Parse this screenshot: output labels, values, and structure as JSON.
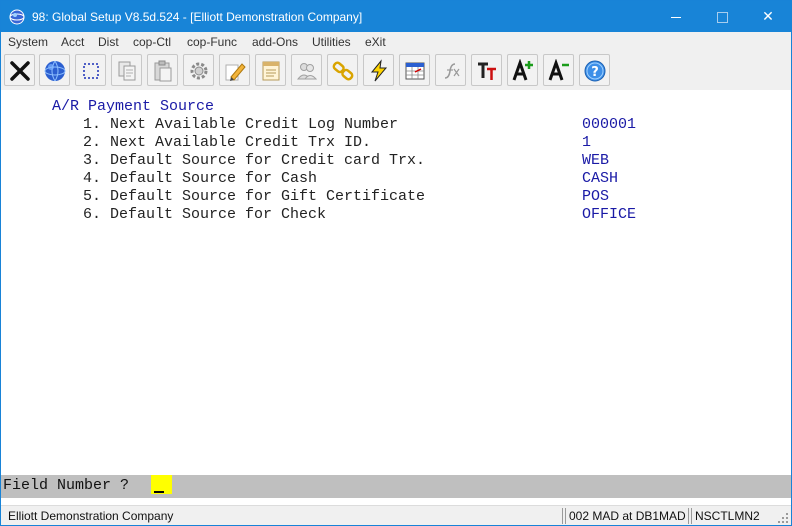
{
  "window": {
    "title": "98: Global Setup V8.5d.524 - [Elliott Demonstration Company]",
    "controls": {
      "minimize": "minimize",
      "maximize": "maximize",
      "close": "✕"
    }
  },
  "menubar": {
    "items": [
      {
        "label": "System"
      },
      {
        "label": "Acct"
      },
      {
        "label": "Dist"
      },
      {
        "label": "cop-Ctl"
      },
      {
        "label": "cop-Func"
      },
      {
        "label": "add-Ons"
      },
      {
        "label": "Utilities"
      },
      {
        "label": "eXit"
      }
    ]
  },
  "toolbar": {
    "buttons": [
      {
        "icon": "exit-x-icon"
      },
      {
        "icon": "globe-icon"
      },
      {
        "icon": "select-box-icon"
      },
      {
        "icon": "copy-icon"
      },
      {
        "icon": "paste-icon"
      },
      {
        "icon": "settings-gear-icon"
      },
      {
        "icon": "pencil-edit-icon"
      },
      {
        "icon": "notepad-icon"
      },
      {
        "icon": "users-icon"
      },
      {
        "icon": "chain-link-icon"
      },
      {
        "icon": "lightning-icon"
      },
      {
        "icon": "spreadsheet-icon"
      },
      {
        "icon": "function-icon"
      },
      {
        "icon": "font-type-icon"
      },
      {
        "icon": "font-increase-icon"
      },
      {
        "icon": "font-decrease-icon"
      },
      {
        "icon": "help-icon"
      }
    ]
  },
  "screen": {
    "title": "A/R Payment Source",
    "fields": [
      {
        "label": "1. Next Available Credit Log Number",
        "value": "000001"
      },
      {
        "label": "2. Next Available Credit Trx ID.",
        "value": "1"
      },
      {
        "label": "3. Default Source for Credit card Trx.",
        "value": "WEB"
      },
      {
        "label": "4. Default Source for Cash",
        "value": "CASH"
      },
      {
        "label": "5. Default Source for Gift Certificate",
        "value": "POS"
      },
      {
        "label": "6. Default Source for Check",
        "value": "OFFICE"
      }
    ]
  },
  "prompt": {
    "label": "Field Number ?",
    "value": ""
  },
  "statusbar": {
    "company": "Elliott Demonstration Company",
    "database": "002 MAD at DB1MAD",
    "screen_id": "NSCTLMN2"
  },
  "colors": {
    "titlebar": "#1884d7",
    "field_text": "#1a1aa6",
    "prompt_input": "#ffff00"
  }
}
